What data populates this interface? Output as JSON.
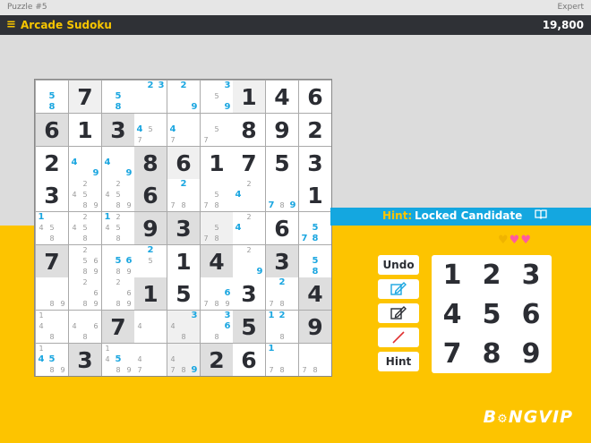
{
  "topbar": {
    "puzzle": "Puzzle #5",
    "level": "Expert"
  },
  "titlebar": {
    "menu": "≡",
    "title": "Arcade Sudoku",
    "score": "19,800"
  },
  "hint": {
    "label": "Hint:",
    "value": "Locked Candidate",
    "book_icon": "book-icon"
  },
  "hearts": [
    "♥",
    "♥",
    "♥"
  ],
  "buttons": {
    "undo": "Undo",
    "hint": "Hint",
    "pencil_icon": "pencil-icon",
    "pen_icon": "pen-icon",
    "eraser_icon": "slash-icon"
  },
  "pad": [
    "1",
    "2",
    "3",
    "4",
    "5",
    "6",
    "7",
    "8",
    "9"
  ],
  "board": [
    [
      {
        "c": [
          {
            "d": "5",
            "h": true
          },
          {
            "d": "8",
            "h": true
          }
        ]
      },
      {
        "v": "7"
      },
      {
        "c": [
          {
            "d": "5",
            "h": true
          },
          {
            "d": "8",
            "h": true
          }
        ]
      },
      {
        "c": [
          {
            "d": "2",
            "h": true
          },
          {
            "d": "3",
            "h": true
          }
        ]
      },
      {
        "c": [
          {
            "d": "2",
            "h": true
          },
          {
            "d": "9",
            "h": true
          }
        ]
      },
      {
        "c": [
          {
            "d": "3",
            "h": true
          },
          {
            "d": "5"
          },
          {
            "d": "9",
            "h": true
          }
        ]
      },
      {
        "v": "1"
      },
      {
        "v": "4"
      },
      {
        "v": "6"
      }
    ],
    [
      {
        "v": "6"
      },
      {
        "v": "1"
      },
      {
        "v": "3"
      },
      {
        "c": [
          {
            "d": "4",
            "h": true
          },
          {
            "d": "5"
          },
          {
            "d": "7"
          }
        ]
      },
      {
        "c": [
          {
            "d": "4",
            "h": true
          },
          {
            "d": "7"
          }
        ]
      },
      {
        "c": [
          {
            "d": "5"
          },
          {
            "d": "7"
          }
        ]
      },
      {
        "v": "8"
      },
      {
        "v": "9"
      },
      {
        "v": "2"
      }
    ],
    [
      {
        "v": "2"
      },
      {
        "c": [
          {
            "d": "4",
            "h": true
          },
          {
            "d": "9",
            "h": true
          }
        ]
      },
      {
        "c": [
          {
            "d": "4",
            "h": true
          },
          {
            "d": "9",
            "h": true
          }
        ]
      },
      {
        "v": "8"
      },
      {
        "v": "6"
      },
      {
        "v": "1"
      },
      {
        "v": "7"
      },
      {
        "v": "5"
      },
      {
        "v": "3"
      }
    ],
    [
      {
        "v": "3"
      },
      {
        "c": [
          {
            "d": "2"
          },
          {
            "d": "4"
          },
          {
            "d": "5"
          },
          {
            "d": "8"
          },
          {
            "d": "9"
          }
        ]
      },
      {
        "c": [
          {
            "d": "2"
          },
          {
            "d": "4"
          },
          {
            "d": "5"
          },
          {
            "d": "8"
          },
          {
            "d": "9"
          }
        ]
      },
      {
        "v": "6"
      },
      {
        "c": [
          {
            "d": "2",
            "h": true
          },
          {
            "d": "7"
          },
          {
            "d": "8"
          }
        ]
      },
      {
        "c": [
          {
            "d": "5"
          },
          {
            "d": "7"
          },
          {
            "d": "8"
          }
        ]
      },
      {
        "c": [
          {
            "d": "2"
          },
          {
            "d": "4",
            "h": true
          }
        ]
      },
      {
        "c": [
          {
            "d": "9",
            "h": true
          },
          {
            "d": "7",
            "h": true
          },
          {
            "d": "8"
          }
        ]
      },
      {
        "v": "1"
      }
    ],
    [
      {
        "c": [
          {
            "d": "1",
            "h": true
          },
          {
            "d": "4"
          },
          {
            "d": "5"
          },
          {
            "d": "8"
          }
        ]
      },
      {
        "c": [
          {
            "d": "2"
          },
          {
            "d": "4"
          },
          {
            "d": "5"
          },
          {
            "d": "8"
          }
        ]
      },
      {
        "c": [
          {
            "d": "1",
            "h": true
          },
          {
            "d": "2"
          },
          {
            "d": "4"
          },
          {
            "d": "5"
          },
          {
            "d": "8"
          }
        ]
      },
      {
        "v": "9"
      },
      {
        "v": "3"
      },
      {
        "c": [
          {
            "d": "5"
          },
          {
            "d": "7"
          },
          {
            "d": "8"
          }
        ]
      },
      {
        "c": [
          {
            "d": "2"
          },
          {
            "d": "4",
            "h": true
          }
        ]
      },
      {
        "v": "6"
      },
      {
        "c": [
          {
            "d": "5",
            "h": true
          },
          {
            "d": "7",
            "h": true
          },
          {
            "d": "8",
            "h": true
          }
        ]
      }
    ],
    [
      {
        "v": "7"
      },
      {
        "c": [
          {
            "d": "2"
          },
          {
            "d": "5"
          },
          {
            "d": "6"
          },
          {
            "d": "8"
          },
          {
            "d": "9"
          }
        ]
      },
      {
        "c": [
          {
            "d": "5",
            "h": true
          },
          {
            "d": "6",
            "h": true
          },
          {
            "d": "8"
          },
          {
            "d": "9"
          }
        ]
      },
      {
        "c": [
          {
            "d": "2",
            "h": true
          },
          {
            "d": "5"
          }
        ]
      },
      {
        "v": "1"
      },
      {
        "v": "4"
      },
      {
        "c": [
          {
            "d": "2"
          },
          {
            "d": "9",
            "h": true
          }
        ]
      },
      {
        "v": "3"
      },
      {
        "c": [
          {
            "d": "5",
            "h": true
          },
          {
            "d": "8",
            "h": true
          }
        ]
      }
    ],
    [
      {
        "c": [
          {
            "d": "8"
          },
          {
            "d": "9"
          }
        ]
      },
      {
        "c": [
          {
            "d": "2"
          },
          {
            "d": "6"
          },
          {
            "d": "8"
          },
          {
            "d": "9"
          }
        ]
      },
      {
        "c": [
          {
            "d": "2"
          },
          {
            "d": "6"
          },
          {
            "d": "8"
          },
          {
            "d": "9"
          }
        ]
      },
      {
        "v": "1"
      },
      {
        "v": "5"
      },
      {
        "c": [
          {
            "d": "6",
            "h": true
          },
          {
            "d": "7"
          },
          {
            "d": "8"
          },
          {
            "d": "9"
          }
        ]
      },
      {
        "v": "3"
      },
      {
        "c": [
          {
            "d": "2",
            "h": true
          },
          {
            "d": "7"
          },
          {
            "d": "8"
          }
        ]
      },
      {
        "v": "4"
      }
    ],
    [
      {
        "c": [
          {
            "d": "1"
          },
          {
            "d": "4"
          },
          {
            "d": "8"
          }
        ]
      },
      {
        "c": [
          {
            "d": "4"
          },
          {
            "d": "6"
          },
          {
            "d": "8"
          }
        ]
      },
      {
        "v": "7"
      },
      {
        "c": [
          {
            "d": "4"
          }
        ]
      },
      {
        "c": [
          {
            "d": "3",
            "h": true
          },
          {
            "d": "4"
          },
          {
            "d": "8"
          }
        ]
      },
      {
        "c": [
          {
            "d": "3",
            "h": true
          },
          {
            "d": "6",
            "h": true
          },
          {
            "d": "8"
          }
        ]
      },
      {
        "v": "5"
      },
      {
        "c": [
          {
            "d": "1",
            "h": true
          },
          {
            "d": "2",
            "h": true
          },
          {
            "d": "8"
          }
        ]
      },
      {
        "v": "9"
      }
    ],
    [
      {
        "c": [
          {
            "d": "1"
          },
          {
            "d": "4",
            "h": true
          },
          {
            "d": "5",
            "h": true
          },
          {
            "d": "8"
          },
          {
            "d": "9"
          }
        ]
      },
      {
        "v": "3"
      },
      {
        "c": [
          {
            "d": "1"
          },
          {
            "d": "4"
          },
          {
            "d": "5",
            "h": true
          },
          {
            "d": "8"
          },
          {
            "d": "9"
          }
        ]
      },
      {
        "c": [
          {
            "d": "4"
          },
          {
            "d": "7"
          }
        ]
      },
      {
        "c": [
          {
            "d": "4"
          },
          {
            "d": "7"
          },
          {
            "d": "8"
          },
          {
            "d": "9",
            "h": true
          }
        ]
      },
      {
        "v": "2"
      },
      {
        "v": "6"
      },
      {
        "c": [
          {
            "d": "1",
            "h": true
          },
          {
            "d": "7"
          },
          {
            "d": "8"
          }
        ]
      },
      {
        "c": [
          {
            "d": "7"
          },
          {
            "d": "8"
          }
        ]
      }
    ]
  ]
}
